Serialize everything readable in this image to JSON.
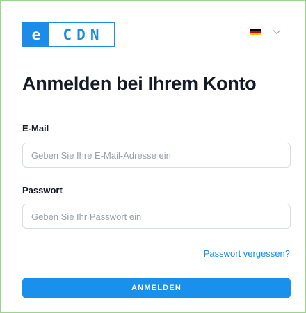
{
  "brand": {
    "logo_letter": "e",
    "logo_text": "CDN",
    "color": "#1d8ce8"
  },
  "language": {
    "flag": "de-flag-icon",
    "flag_colors": [
      "#000000",
      "#dd0000",
      "#ffce00"
    ]
  },
  "page": {
    "title": "Anmelden bei Ihrem Konto"
  },
  "form": {
    "email": {
      "label": "E-Mail",
      "placeholder": "Geben Sie Ihre E-Mail-Adresse ein",
      "value": ""
    },
    "password": {
      "label": "Passwort",
      "placeholder": "Geben Sie Ihr Passwort ein",
      "value": ""
    },
    "forgot_link": "Passwort vergessen?",
    "submit_label": "ANMELDEN"
  }
}
